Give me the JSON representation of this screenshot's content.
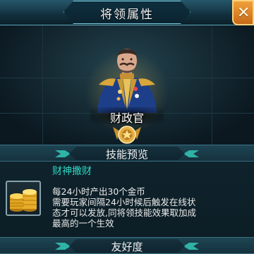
{
  "title": "将领属性",
  "close_icon": "close-x-icon",
  "general": {
    "rank": "财政官",
    "emblem_icon": "rank-emblem-icon"
  },
  "sections": {
    "skill_preview": "技能预览",
    "friendship": "友好度"
  },
  "skill": {
    "name": "财神撒财",
    "icon": "gold-coins-icon",
    "description_lines": [
      "每24小时产出30个金币",
      "需要玩家间隔24小时候后触发在线状",
      "态才可以发放,同将领技能效果取加成",
      "最高的一个生效"
    ]
  },
  "colors": {
    "accent_teal": "#2fd6c4",
    "close_orange": "#e08a2a",
    "gold": "#e6b04a"
  }
}
